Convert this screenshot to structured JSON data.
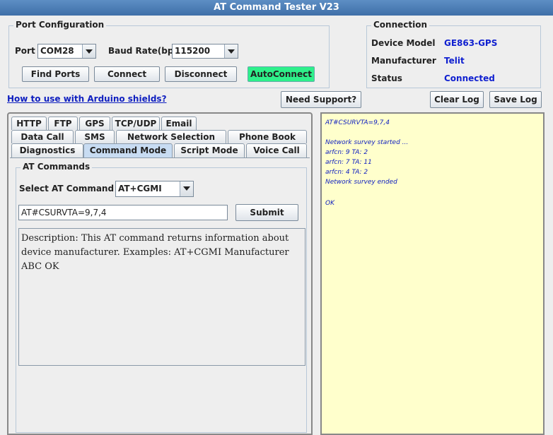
{
  "window": {
    "title": "AT Command Tester V23"
  },
  "port_config": {
    "title": "Port Configuration",
    "port_label": "Port",
    "port_value": "COM28",
    "baud_label": "Baud Rate(bps)",
    "baud_value": "115200",
    "find_ports": "Find Ports",
    "connect": "Connect",
    "disconnect": "Disconnect",
    "autoconnect": "AutoConnect",
    "autoconnect_color": "#2ef08a"
  },
  "connection": {
    "title": "Connection",
    "device_model_label": "Device Model",
    "device_model_value": "GE863-GPS",
    "manufacturer_label": "Manufacturer",
    "manufacturer_value": "Telit",
    "status_label": "Status",
    "status_value": "Connected",
    "value_color": "#1020d0"
  },
  "toolbar": {
    "help_link": "How to use with Arduino shields?",
    "need_support": "Need Support?",
    "clear_log": "Clear Log",
    "save_log": "Save Log"
  },
  "tabs": {
    "row1": [
      "HTTP",
      "FTP",
      "GPS",
      "TCP/UDP",
      "Email"
    ],
    "row2": [
      "Data Call",
      "SMS",
      "Network Selection",
      "Phone Book"
    ],
    "row3": [
      "Diagnostics",
      "Command Mode",
      "Script Mode",
      "Voice Call"
    ],
    "active": "Command Mode"
  },
  "at_commands": {
    "title": "AT Commands",
    "select_label": "Select AT Command",
    "select_value": "AT+CGMI",
    "command_input": "AT#CSURVTA=9,7,4",
    "submit": "Submit",
    "description": "Description: This AT command returns information about device manufacturer. Examples: AT+CGMI Manufacturer ABC OK"
  },
  "log": {
    "background": "#ffffcc",
    "lines": [
      "AT#CSURVTA=9,7,4",
      "",
      "Network survey started ...",
      "arfcn: 9 TA: 2",
      "arfcn: 7 TA: 11",
      "arfcn: 4 TA: 2",
      "Network survey ended",
      "",
      "OK"
    ]
  }
}
